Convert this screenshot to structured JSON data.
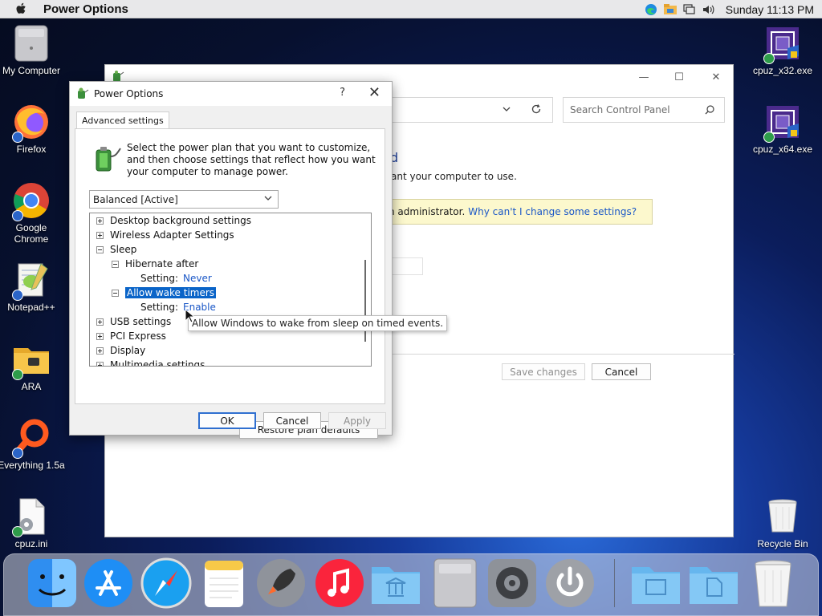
{
  "menubar": {
    "app_name": "Power Options",
    "clock": "Sunday 11:13 PM"
  },
  "desktop": {
    "icons": [
      {
        "label": "My Computer"
      },
      {
        "label": "Firefox"
      },
      {
        "label": "Google Chrome"
      },
      {
        "label": "Notepad++"
      },
      {
        "label": "ARA"
      },
      {
        "label": "Everything 1.5a"
      },
      {
        "label": "cpuz.ini"
      },
      {
        "label": "cpuz_x32.exe"
      },
      {
        "label": "cpuz_x64.exe"
      },
      {
        "label": "Recycle Bin"
      }
    ]
  },
  "control_panel": {
    "search_placeholder": "Search Control Panel",
    "heading_fragment": "d",
    "desc_fragment": "ant your computer to use.",
    "info_text": "n administrator.",
    "info_link": "Why can't I change some settings?",
    "save_label": "Save changes",
    "cancel_label": "Cancel"
  },
  "dialog": {
    "title": "Power Options",
    "help": "?",
    "close": "✕",
    "tab": "Advanced settings",
    "intro": "Select the power plan that you want to customize, and then choose settings that reflect how you want your computer to manage power.",
    "plan": "Balanced [Active]",
    "tree": {
      "desktop_bg": "Desktop background settings",
      "wireless": "Wireless Adapter Settings",
      "sleep": "Sleep",
      "hibernate": "Hibernate after",
      "hibernate_setting_label": "Setting:",
      "hibernate_setting_value": "Never",
      "wake_timers": "Allow wake timers",
      "wake_setting_label": "Setting:",
      "wake_setting_value": "Enable",
      "usb": "USB settings",
      "pci": "PCI Express",
      "display": "Display",
      "multimedia": "Multimedia settings"
    },
    "restore_label": "Restore plan defaults",
    "ok_label": "OK",
    "cancel_label": "Cancel",
    "apply_label": "Apply",
    "tooltip": "Allow Windows to wake from sleep on timed events."
  },
  "dock": {
    "items": [
      "finder-icon",
      "app-store-icon",
      "safari-icon",
      "notes-icon",
      "launchpad-icon",
      "music-icon",
      "applications-folder-icon",
      "my-computer-icon",
      "system-preferences-icon",
      "power-icon",
      "documents-folder-icon",
      "downloads-folder-icon",
      "trash-icon"
    ]
  }
}
